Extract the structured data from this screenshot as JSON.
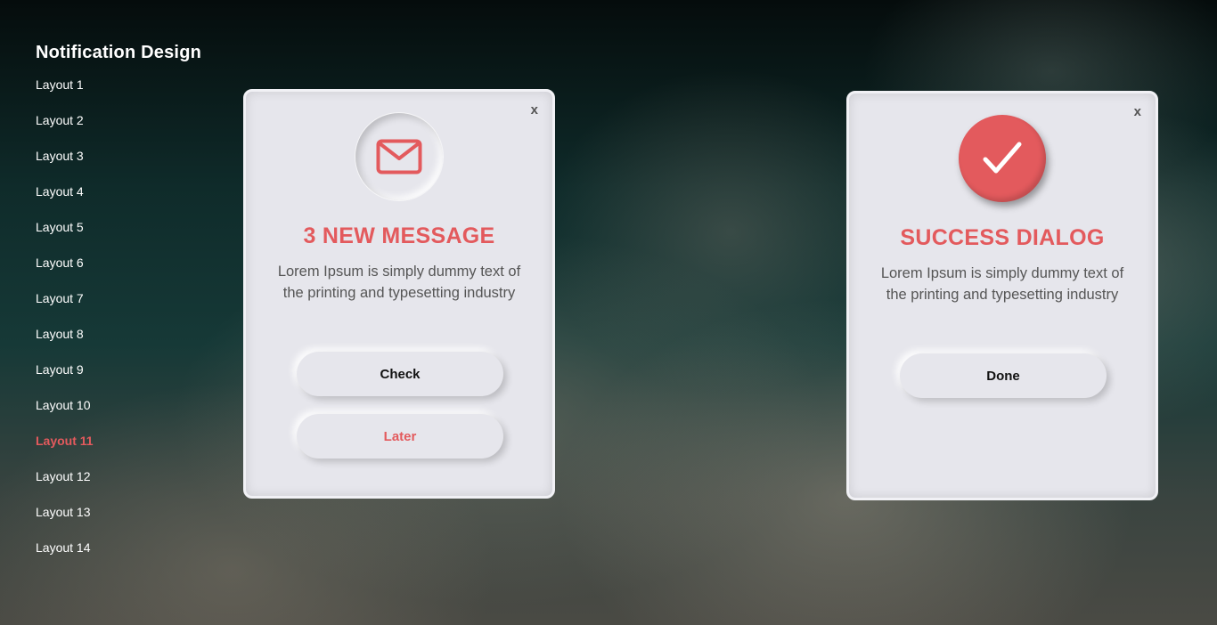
{
  "sidebar": {
    "title": "Notification Design",
    "active_index": 10,
    "items": [
      {
        "label": "Layout 1"
      },
      {
        "label": "Layout 2"
      },
      {
        "label": "Layout 3"
      },
      {
        "label": "Layout 4"
      },
      {
        "label": "Layout 5"
      },
      {
        "label": "Layout 6"
      },
      {
        "label": "Layout 7"
      },
      {
        "label": "Layout 8"
      },
      {
        "label": "Layout 9"
      },
      {
        "label": "Layout 10"
      },
      {
        "label": "Layout 11"
      },
      {
        "label": "Layout 12"
      },
      {
        "label": "Layout 13"
      },
      {
        "label": "Layout 14"
      }
    ]
  },
  "message_card": {
    "close_label": "x",
    "icon": "envelope-icon",
    "title": "3 NEW MESSAGE",
    "text": "Lorem Ipsum is simply dummy text of the printing and typesetting industry",
    "check_label": "Check",
    "later_label": "Later"
  },
  "success_card": {
    "close_label": "x",
    "icon": "checkmark-icon",
    "title": "SUCCESS DIALOG",
    "text": "Lorem Ipsum is simply dummy text of the printing and typesetting industry",
    "done_label": "Done"
  },
  "colors": {
    "accent": "#e35a5d",
    "card_background": "#e6e6ec",
    "sidebar_text": "#ffffff"
  }
}
